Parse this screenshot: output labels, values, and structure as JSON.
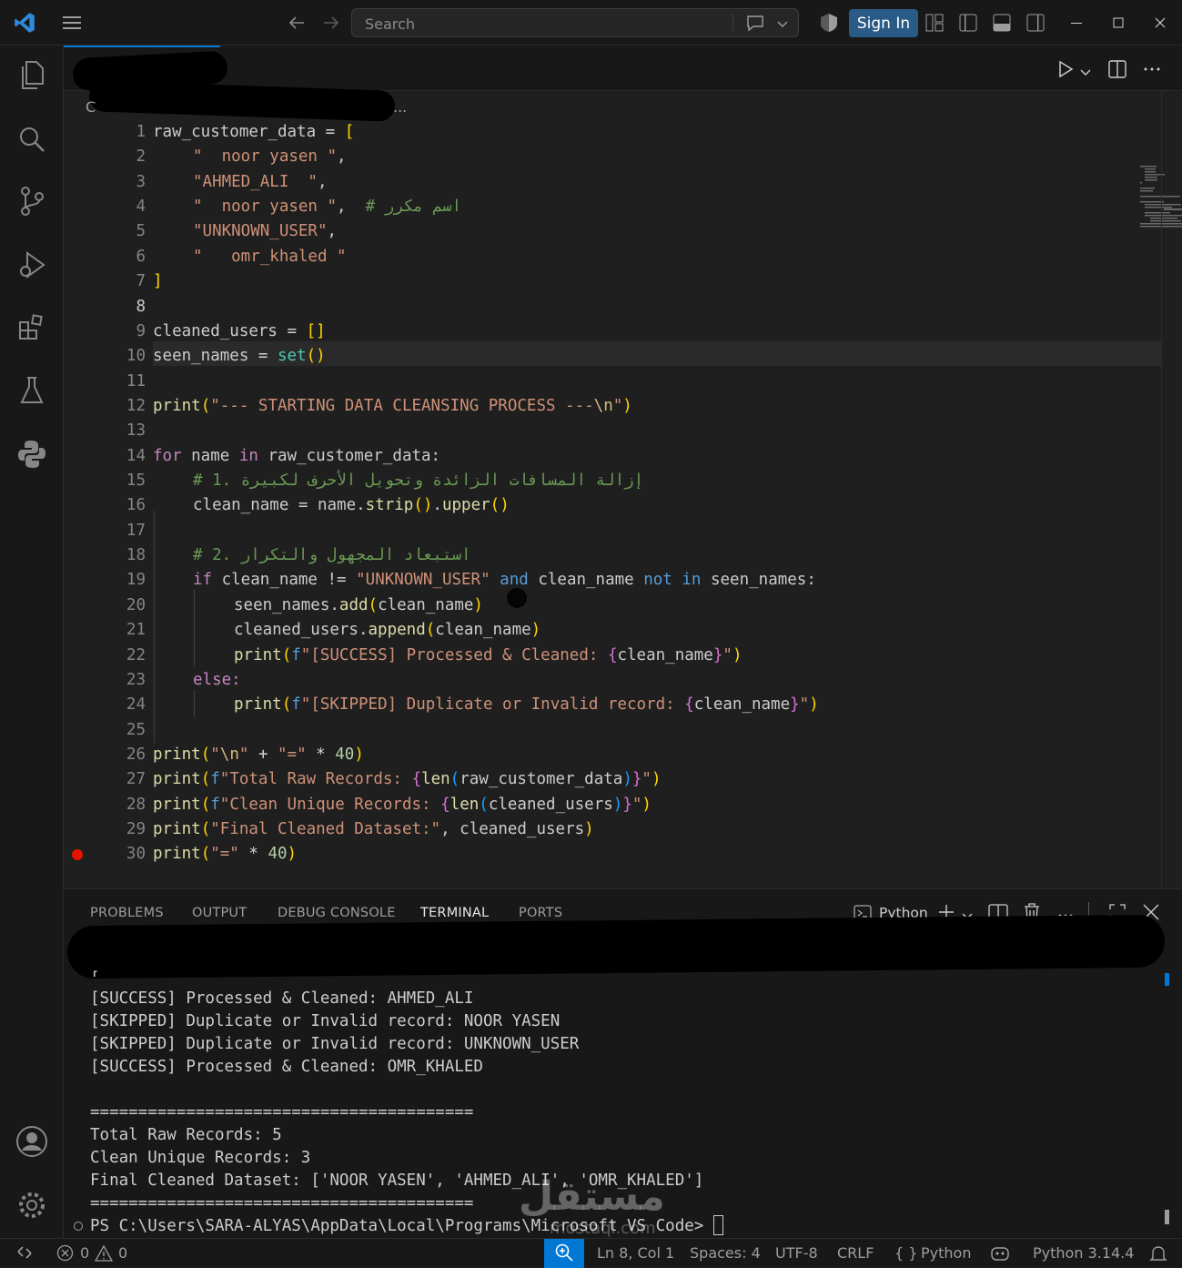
{
  "titlebar": {
    "search_placeholder": "Search",
    "signin_label": "Sign In"
  },
  "editor": {
    "breadcrumb_tail": "...",
    "code_lines": [
      "1",
      "2",
      "3",
      "4",
      "5",
      "6",
      "7",
      "8",
      "9",
      "10",
      "11",
      "12",
      "13",
      "14",
      "15",
      "16",
      "17",
      "18",
      "19",
      "20",
      "21",
      "22",
      "23",
      "24",
      "25",
      "26",
      "27",
      "28",
      "29",
      "30"
    ],
    "current_line": "8",
    "code": {
      "l1a": "raw_customer_data",
      "l1b": " = ",
      "l1c": "[",
      "l2": "\"  noor yasen \"",
      "l2c": ",",
      "l3": "\"AHMED_ALI  \"",
      "l3c": ",",
      "l4": "\"  noor yasen \"",
      "l4c": ",  ",
      "l4com": "# اسم مكرر",
      "l5": "\"UNKNOWN_USER\"",
      "l5c": ",",
      "l6": "\"   omr_khaled \"",
      "l7": "]",
      "l9a": "cleaned_users",
      "l9b": " = ",
      "l9c": "[]",
      "l10a": "seen_names",
      "l10b": " = ",
      "l10c": "set",
      "l10d": "()",
      "l12a": "print",
      "l12b": "(",
      "l12c": "\"--- STARTING DATA CLEANSING PROCESS ---",
      "l12d": "\\n",
      "l12e": "\"",
      "l12f": ")",
      "l14a": "for",
      "l14b": " name ",
      "l14c": "in",
      "l14d": " raw_customer_data:",
      "l15": "# 1. إزالة المسافات الزائدة وتحويل الأحرف لكبيرة",
      "l16a": "clean_name = name.",
      "l16b": "strip",
      "l16c": "()",
      "l16d": ".",
      "l16e": "upper",
      "l16f": "()",
      "l18": "# 2. استبعاد المجهول والتكرار",
      "l19a": "if",
      "l19b": " clean_name != ",
      "l19c": "\"UNKNOWN_USER\"",
      "l19d": " and",
      "l19e": " clean_name ",
      "l19f": "not in",
      "l19g": " seen_names:",
      "l20a": "seen_names.",
      "l20b": "add",
      "l20c": "(",
      "l20d": "clean_name",
      "l20e": ")",
      "l21a": "cleaned_users.",
      "l21b": "append",
      "l21c": "(",
      "l21d": "clean_name",
      "l21e": ")",
      "l22a": "print",
      "l22b": "(",
      "l22c": "f",
      "l22d": "\"[SUCCESS] Processed & Cleaned: ",
      "l22e": "{",
      "l22f": "clean_name",
      "l22g": "}",
      "l22h": "\"",
      "l22i": ")",
      "l23": "else:",
      "l24a": "print",
      "l24b": "(",
      "l24c": "f",
      "l24d": "\"[SKIPPED] Duplicate or Invalid record: ",
      "l24e": "{",
      "l24f": "clean_name",
      "l24g": "}",
      "l24h": "\"",
      "l24i": ")",
      "l26a": "print",
      "l26b": "(",
      "l26c": "\"",
      "l26d": "\\n",
      "l26e": "\"",
      "l26f": " + ",
      "l26g": "\"=\"",
      "l26h": " * ",
      "l26i": "40",
      "l26j": ")",
      "l27a": "print",
      "l27b": "(",
      "l27c": "f",
      "l27d": "\"Total Raw Records: ",
      "l27e": "{",
      "l27f": "len",
      "l27g": "(",
      "l27h": "raw_customer_data",
      "l27i": ")",
      "l27j": "}",
      "l27k": "\"",
      "l27l": ")",
      "l28a": "print",
      "l28b": "(",
      "l28c": "f",
      "l28d": "\"Clean Unique Records: ",
      "l28e": "{",
      "l28f": "len",
      "l28g": "(",
      "l28h": "cleaned_users",
      "l28i": ")",
      "l28j": "}",
      "l28k": "\"",
      "l28l": ")",
      "l29a": "print",
      "l29b": "(",
      "l29c": "\"Final Cleaned Dataset:\"",
      "l29d": ", cleaned_users",
      "l29e": ")",
      "l30a": "print",
      "l30b": "(",
      "l30c": "\"=\"",
      "l30d": " * ",
      "l30e": "40",
      "l30f": ")"
    }
  },
  "panel": {
    "tabs": [
      "PROBLEMS",
      "OUTPUT",
      "DEBUG CONSOLE",
      "TERMINAL",
      "PORTS"
    ],
    "active_tab": "TERMINAL",
    "shell_label": "Python",
    "terminal_lines": [
      "[SUCCESS] Processed & Cleaned: AHMED_ALI",
      "[SKIPPED] Duplicate or Invalid record: NOOR YASEN",
      "[SKIPPED] Duplicate or Invalid record: UNKNOWN_USER",
      "[SUCCESS] Processed & Cleaned: OMR_KHALED",
      "",
      "========================================",
      "Total Raw Records: 5",
      "Clean Unique Records: 3",
      "Final Cleaned Dataset: ['NOOR YASEN', 'AHMED_ALI', 'OMR_KHALED']",
      "========================================",
      "PS C:\\Users\\SARA-ALYAS\\AppData\\Local\\Programs\\Microsoft VS Code> "
    ],
    "partial_top_line": "[",
    "watermark": "مستقل",
    "watermark_sub": "mostaql.com"
  },
  "statusbar": {
    "errors": "0",
    "warnings": "0",
    "position": "Ln 8, Col 1",
    "spaces": "Spaces: 4",
    "encoding": "UTF-8",
    "eol": "CRLF",
    "language": "Python",
    "interpreter": "Python 3.14.4"
  },
  "colors": {
    "accent": "#0078d4",
    "signin": "#2a5a86",
    "breakpoint": "#e51400"
  }
}
